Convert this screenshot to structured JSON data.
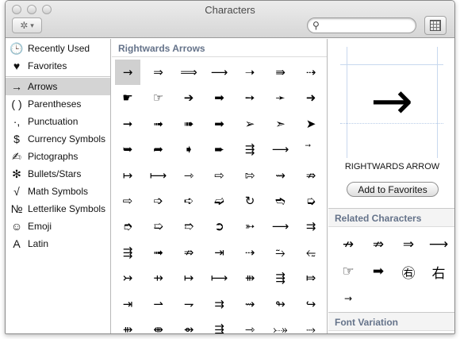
{
  "window": {
    "title": "Characters"
  },
  "toolbar": {
    "gear_glyph": "✲",
    "dropdown_glyph": "▾",
    "search_placeholder": "",
    "search_value": "",
    "search_glyph": "⚲"
  },
  "sidebar": {
    "items": [
      {
        "label": "Recently Used",
        "icon": "🕒",
        "icon_name": "clock-icon"
      },
      {
        "label": "Favorites",
        "icon": "♥",
        "icon_name": "heart-icon"
      },
      {
        "label": "Arrows",
        "icon": "→",
        "icon_name": "arrow-icon",
        "selected": true
      },
      {
        "label": "Parentheses",
        "icon": "( )",
        "icon_name": "parentheses-icon"
      },
      {
        "label": "Punctuation",
        "icon": "·,",
        "icon_name": "punctuation-icon"
      },
      {
        "label": "Currency Symbols",
        "icon": "$",
        "icon_name": "dollar-icon"
      },
      {
        "label": "Pictographs",
        "icon": "✍",
        "icon_name": "pictograph-icon"
      },
      {
        "label": "Bullets/Stars",
        "icon": "✻",
        "icon_name": "star-icon"
      },
      {
        "label": "Math Symbols",
        "icon": "√",
        "icon_name": "sqrt-icon"
      },
      {
        "label": "Letterlike Symbols",
        "icon": "№",
        "icon_name": "numero-icon"
      },
      {
        "label": "Emoji",
        "icon": "☺",
        "icon_name": "smiley-icon"
      },
      {
        "label": "Latin",
        "icon": "A",
        "icon_name": "latin-a-icon"
      }
    ]
  },
  "grid": {
    "header": "Rightwards Arrows",
    "rows": [
      [
        "→",
        "⇒",
        "⟹",
        "⟶",
        "➝",
        "⇛",
        "⇢"
      ],
      [
        "☛",
        "☞",
        "➔",
        "➡",
        "➙",
        "➛",
        "➜"
      ],
      [
        "➞",
        "➟",
        "➠",
        "➡",
        "➢",
        "➣",
        "➤"
      ],
      [
        "➥",
        "➦",
        "➧",
        "➨",
        "⇶",
        "⟶",
        "⃗"
      ],
      [
        "↦",
        "⟼",
        "⇾",
        "⇨",
        "⇰",
        "⇝",
        "⇏"
      ],
      [
        "⇨",
        "➩",
        "➪",
        "➫",
        "↻",
        "➬",
        "➭"
      ],
      [
        "➮",
        "➯",
        "➱",
        "➲",
        "➳",
        "⟶",
        "⇉"
      ],
      [
        "⇶",
        "➟",
        "⇏",
        "⇥",
        "⇢",
        "⥲",
        "⥳"
      ],
      [
        "↣",
        "⇸",
        "↦",
        "⟼",
        "⇻",
        "⇶",
        "⤇"
      ],
      [
        "⇥",
        "⇀",
        "⇁",
        "⇉",
        "⇝",
        "↬",
        "↪"
      ],
      [
        "⇻",
        "⇼",
        "⇴",
        "⇶",
        "⇾",
        "⤐",
        "⤑"
      ]
    ]
  },
  "detail": {
    "glyph": "→",
    "name": "RIGHTWARDS ARROW",
    "favorites_label": "Add to Favorites"
  },
  "related": {
    "header": "Related Characters",
    "items": [
      "↛",
      "⇏",
      "⇒",
      "⟶",
      "☞",
      "➡",
      "㊨",
      "右",
      "→"
    ]
  },
  "font_variation": {
    "header": "Font Variation"
  }
}
